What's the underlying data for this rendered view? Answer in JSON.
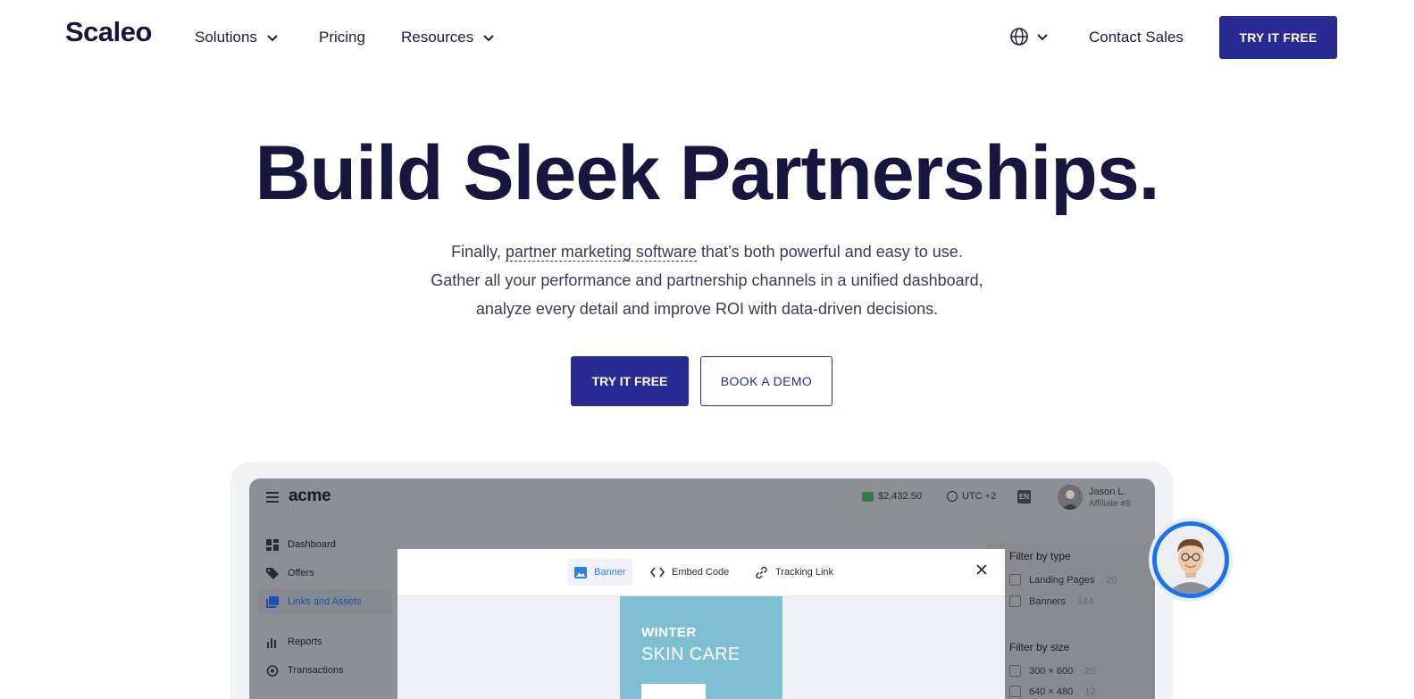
{
  "brand": {
    "logo": "Scaleo"
  },
  "nav": {
    "solutions": "Solutions",
    "pricing": "Pricing",
    "resources": "Resources",
    "contact": "Contact Sales",
    "cta": "TRY IT FREE"
  },
  "hero": {
    "title": "Build Sleek Partnerships.",
    "sub_prefix": "Finally, ",
    "sub_link": "partner marketing software",
    "sub_suffix": " that’s both powerful and easy to use.",
    "sub_line2": "Gather all your performance and partnership channels in a unified dashboard,",
    "sub_line3": "analyze every detail and improve ROI with data-driven decisions.",
    "cta_primary": "TRY IT FREE",
    "cta_secondary": "BOOK A DEMO"
  },
  "mockup": {
    "app_logo": "acme",
    "balance": "$2,432.50",
    "timezone": "UTC +2",
    "language": "EN",
    "user_name": "Jason L.",
    "user_role": "Affiliate #8",
    "sidebar": [
      {
        "label": "Dashboard",
        "icon": "dashboard-icon"
      },
      {
        "label": "Offers",
        "icon": "tag-icon"
      },
      {
        "label": "Links and Assets",
        "icon": "images-icon",
        "active": true
      },
      {
        "label": "Reports",
        "icon": "bar-chart-icon"
      },
      {
        "label": "Transactions",
        "icon": "transactions-icon"
      }
    ],
    "modal_tabs": [
      {
        "label": "Banner",
        "icon": "image-icon",
        "active": true
      },
      {
        "label": "Embed Code",
        "icon": "code-icon"
      },
      {
        "label": "Tracking Link",
        "icon": "link-icon"
      }
    ],
    "banner": {
      "line1": "WINTER",
      "line2": "SKIN CARE"
    },
    "filters": {
      "type_title": "Filter by type",
      "type_options": [
        {
          "label": "Landing Pages",
          "count": "20"
        },
        {
          "label": "Banners",
          "count": "144"
        }
      ],
      "size_title": "Filter by size",
      "size_options": [
        {
          "label": "300 × 600",
          "count": "20"
        },
        {
          "label": "640 × 480",
          "count": "12"
        }
      ]
    }
  },
  "colors": {
    "primary": "#2a2a94",
    "text": "#16163f",
    "accent_blue": "#1a73e8"
  }
}
